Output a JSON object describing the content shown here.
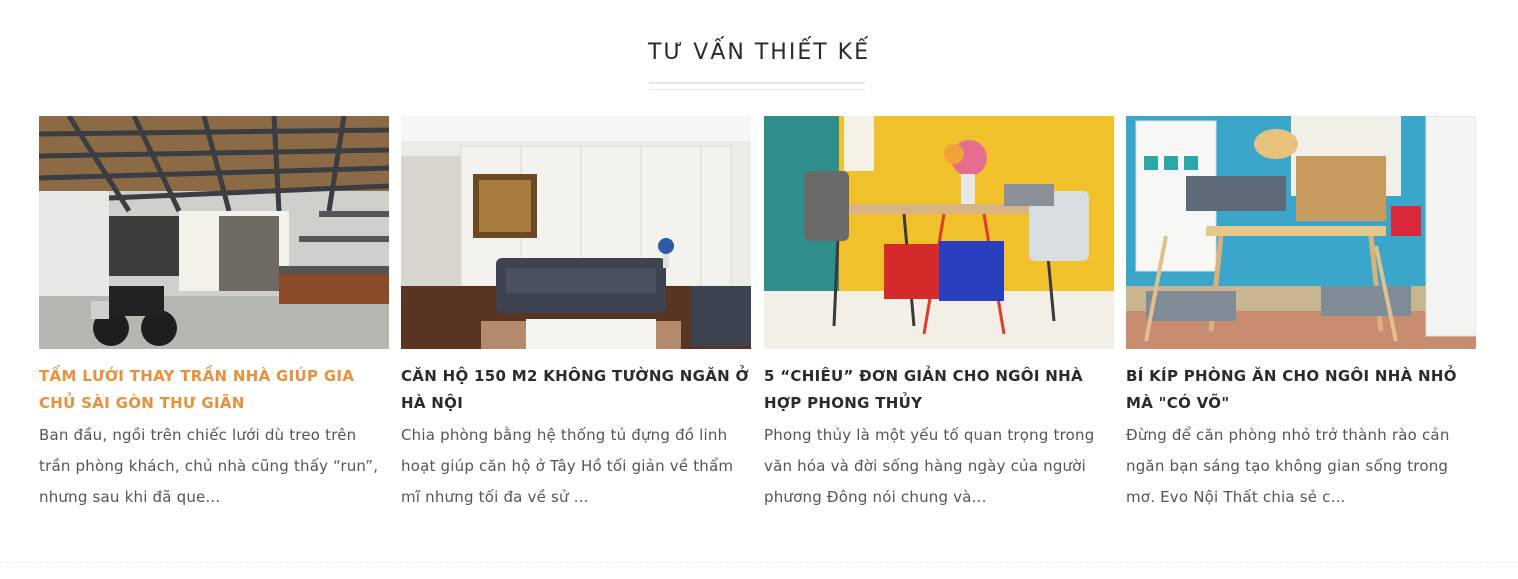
{
  "section": {
    "title": "TƯ VẤN THIẾT KẾ"
  },
  "articles": [
    {
      "title": "TẤM LƯỚI THAY TRẦN NHÀ GIÚP GIA CHỦ SÀI GÒN THƯ GIÃN",
      "excerpt": "Ban đầu, ngồi trên chiếc lưới dù treo trên trần phòng khách, chủ nhà cũng thấy “run”, nhưng sau khi đã que...",
      "image": "loft-net-ceiling-photo",
      "active": true
    },
    {
      "title": "CĂN HỘ 150 M2 KHÔNG TƯỜNG NGĂN Ở HÀ NỘI",
      "excerpt": "Chia phòng bằng hệ thống tủ đựng đồ linh hoạt giúp căn hộ ở Tây Hồ tối giản về thẩm mĩ nhưng tối đa về sử ...",
      "image": "living-room-sofa-photo",
      "active": false
    },
    {
      "title": "5 “CHIÊU” ĐƠN GIẢN CHO NGÔI NHÀ HỢP PHONG THỦY",
      "excerpt": "Phong thủy là một yếu tố quan trọng trong văn hóa và đời sống hàng ngày của người phương Đông nói chung và...",
      "image": "yellow-office-desk-photo",
      "active": false
    },
    {
      "title": "BÍ KÍP PHÒNG ĂN CHO NGÔI NHÀ NHỎ MÀ \"CÓ VÕ\"",
      "excerpt": "Đừng để căn phòng nhỏ trở thành rào cản ngăn bạn sáng tạo không gian sống trong mơ. Evo Nội Thất chia sẻ c...",
      "image": "dining-room-photo",
      "active": false
    }
  ],
  "colors": {
    "accent": "#e8903a",
    "title": "#2b2b2b",
    "text": "#555555"
  }
}
